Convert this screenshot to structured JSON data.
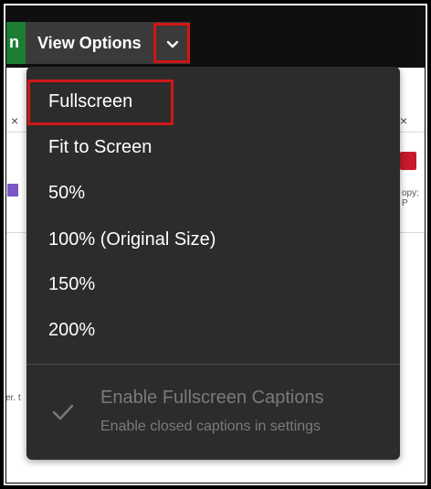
{
  "toolbar": {
    "left_edge_text": "n",
    "view_options_label": "View Options",
    "chevron_icon": "chevron-down-icon"
  },
  "menu": {
    "items": [
      {
        "label": "Fullscreen"
      },
      {
        "label": "Fit to Screen"
      },
      {
        "label": "50%"
      },
      {
        "label": "100% (Original Size)"
      },
      {
        "label": "150%"
      },
      {
        "label": "200%"
      }
    ],
    "captions_title": "Enable Fullscreen Captions",
    "captions_subtitle": "Enable closed captions in settings",
    "captions_icon": "checkmark-icon"
  },
  "background": {
    "close_glyph": "×",
    "snippet_right": "opy: P",
    "snippet_left": "er. t"
  },
  "colors": {
    "highlight": "#d11616",
    "menu_bg": "#2c2c2c",
    "accent_green": "#1e7d34"
  }
}
